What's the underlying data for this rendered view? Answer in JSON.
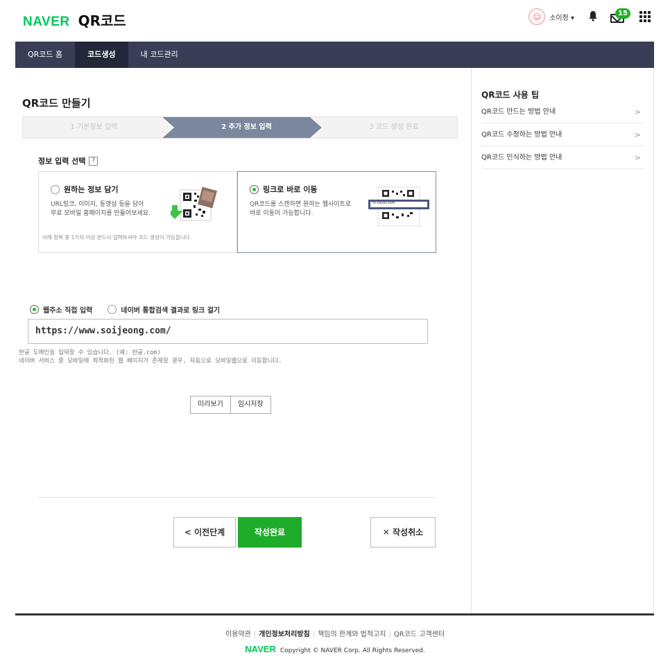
{
  "header": {
    "logo_brand": "NAVER",
    "logo_service": "QR코드",
    "username": "소이정",
    "mail_count": "15"
  },
  "nav": {
    "tabs": [
      {
        "label": "QR코드 홈"
      },
      {
        "label": "코드생성"
      },
      {
        "label": "내 코드관리"
      }
    ]
  },
  "main": {
    "page_title": "QR코드 만들기",
    "steps": [
      "1 기본정보 입력",
      "2 추가 정보 입력",
      "3 코드 생성 완료"
    ],
    "section_label": "정보 입력 선택",
    "help_icon": "?",
    "card_a": {
      "title": "원하는 정보 담기",
      "desc_line1": "URL링크, 이미지, 동영상 등을 담아",
      "desc_line2": "무료 모바일 홈페이지를 만들어보세요.",
      "note": "아래 항목 중 1가지 이상 반드시 입력하셔야 코드 생성이 가능합니다."
    },
    "card_b": {
      "title": "링크로 바로 이동",
      "desc_line1": "QR코드를 스캔하면 원하는 웹사이트로",
      "desc_line2": "바로 이동이 가능합니다.",
      "browser_text": "m.naver.com"
    },
    "input_type": {
      "option_direct": "웹주소 직접 입력",
      "option_search": "네이버 통합검색 결과로 링크 걸기"
    },
    "url_value": "https://www.soijeong.com/",
    "hint_line1": "한글 도메인을 입력할 수 있습니다. (예: 한글.com)",
    "hint_line2": "네이버 서비스 중 모바일에 최적화된 웹 페이지가 존재할 경우, 자동으로 모바일웹으로 이동합니다.",
    "preview_label": "미리보기",
    "save_temp_label": "임시저장",
    "prev_label": "< 이전단계",
    "done_label": "작성완료",
    "cancel_label": "✕ 작성취소"
  },
  "sidebar": {
    "title": "QR코드 사용 팁",
    "items": [
      {
        "label": "QR코드 만드는 방법 안내"
      },
      {
        "label": "QR코드 수정하는 방법 안내"
      },
      {
        "label": "QR코드 인식하는 방법 안내"
      }
    ],
    "arrow": ">"
  },
  "footer": {
    "links": [
      "이용약관",
      "개인정보처리방침",
      "책임의 한계와 법적고지",
      "QR코드 고객센터"
    ],
    "brand": "NAVER",
    "copyright": "Copyright © NAVER Corp. All Rights Reserved."
  },
  "colors": {
    "accent_green": "#1fac2a",
    "nav_bg": "#3a3d56",
    "step_active": "#7a879e"
  }
}
